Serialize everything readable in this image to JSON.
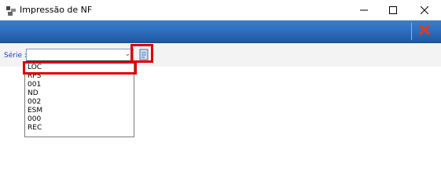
{
  "window": {
    "title": "Impressão de NF",
    "icons": {
      "app": "app-logo-icon",
      "minimize": "minimize-icon",
      "maximize": "maximize-icon",
      "close": "close-icon"
    }
  },
  "toolbar": {
    "close_icon": "red-x-close-icon"
  },
  "form": {
    "serie_label": "Série :",
    "serie_value": "",
    "dropdown_options": [
      "LOC",
      "RPS",
      "001",
      "ND",
      "002",
      "ESM",
      "000",
      "REC"
    ],
    "highlighted_option": "LOC",
    "print_icon": "print-document-icon"
  },
  "colors": {
    "toolbar": "#2f6fbf",
    "highlight": "#e00000",
    "label": "#1f3fbf"
  }
}
